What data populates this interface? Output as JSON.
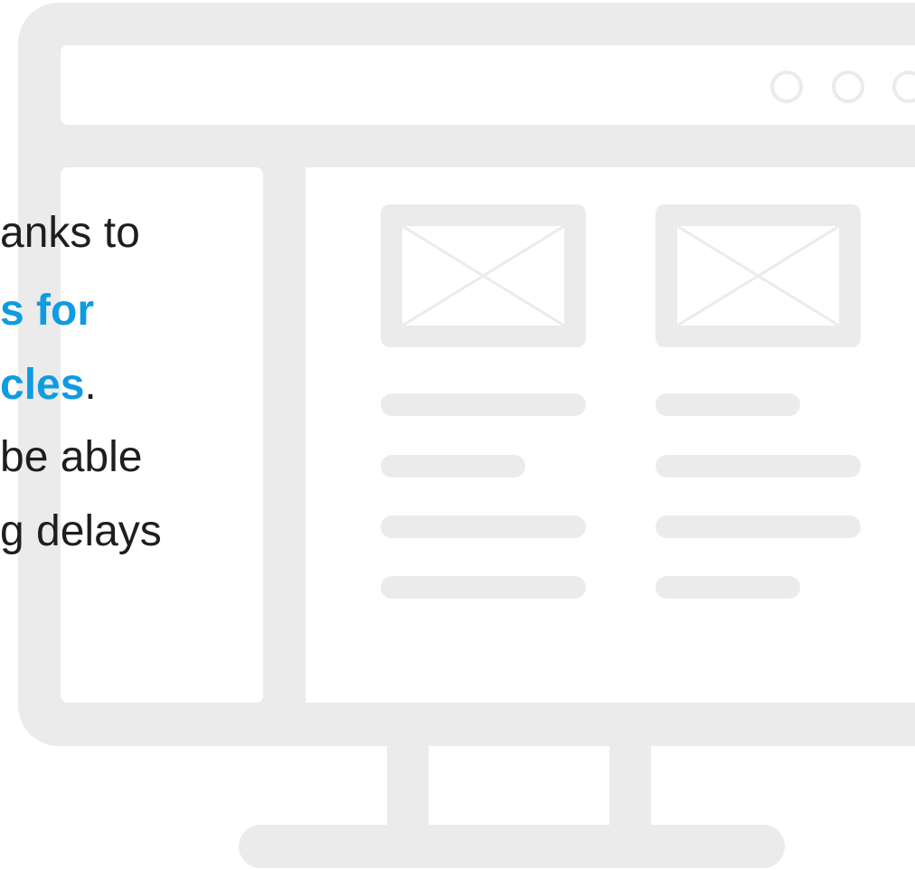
{
  "colors": {
    "frame": "#ebebeb",
    "accent": "#0e9ce0",
    "text": "#1e1e1e",
    "background": "#ffffff"
  },
  "text": {
    "line1": "anks to",
    "line2": "s for",
    "line3_accent": "cles",
    "line3_rest": ".",
    "line4": "be able",
    "line5": "g delays"
  },
  "icons": {
    "window_controls": [
      "circle-icon",
      "circle-icon",
      "circle-icon"
    ],
    "image_placeholders": [
      "image-placeholder-icon",
      "image-placeholder-icon"
    ]
  }
}
